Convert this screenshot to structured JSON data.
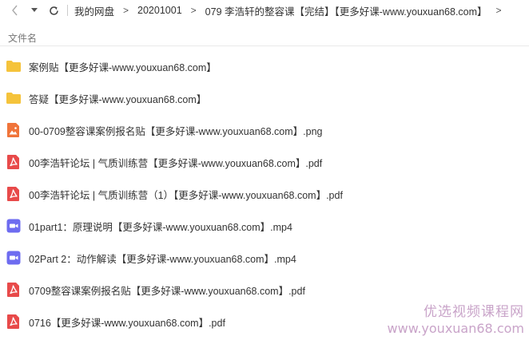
{
  "toolbar": {
    "back_icon": "chevron-left-icon",
    "dropdown_icon": "caret-down-icon",
    "refresh_icon": "refresh-icon",
    "breadcrumbs": [
      {
        "label": "我的网盘"
      },
      {
        "label": "20201001"
      },
      {
        "label": "079 李浩轩的整容课【完结】【更多好课-www.youxuan68.com】"
      }
    ]
  },
  "list_header": {
    "name_label": "文件名"
  },
  "colors": {
    "folder": "#f5c33b",
    "image": "#f0743a",
    "pdf": "#e84a4a",
    "video": "#6e6cf0"
  },
  "files": [
    {
      "name": "案例贴【更多好课-www.youxuan68.com】",
      "type": "folder"
    },
    {
      "name": "答疑【更多好课-www.youxuan68.com】",
      "type": "folder"
    },
    {
      "name": "00-0709整容课案例报名贴【更多好课-www.youxuan68.com】.png",
      "type": "image"
    },
    {
      "name": "00李浩轩论坛 | 气质训练营【更多好课-www.youxuan68.com】.pdf",
      "type": "pdf"
    },
    {
      "name": "00李浩轩论坛 | 气质训练营（1）【更多好课-www.youxuan68.com】.pdf",
      "type": "pdf"
    },
    {
      "name": "01part1：原理说明【更多好课-www.youxuan68.com】.mp4",
      "type": "video"
    },
    {
      "name": "02Part 2：动作解读【更多好课-www.youxuan68.com】.mp4",
      "type": "video"
    },
    {
      "name": "0709整容课案例报名贴【更多好课-www.youxuan68.com】.pdf",
      "type": "pdf"
    },
    {
      "name": "0716【更多好课-www.youxuan68.com】.pdf",
      "type": "pdf"
    }
  ],
  "watermark": {
    "line1": "优选视频课程网",
    "line2": "www.youxuan68.com"
  }
}
